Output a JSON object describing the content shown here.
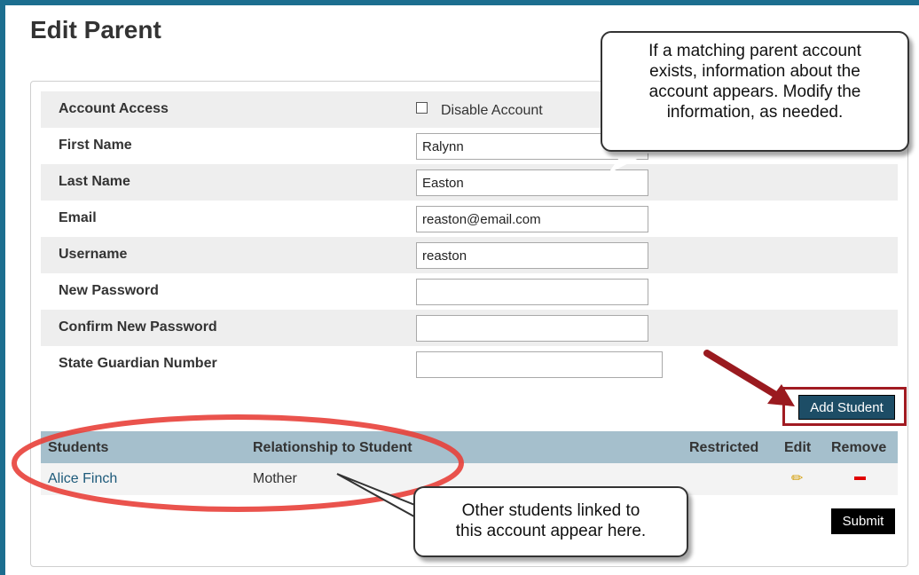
{
  "page": {
    "title": "Edit Parent"
  },
  "form": {
    "account_access": {
      "label": "Account Access",
      "checkbox_label": "Disable Account",
      "checked": false
    },
    "first_name": {
      "label": "First Name",
      "value": "Ralynn"
    },
    "last_name": {
      "label": "Last Name",
      "value": "Easton"
    },
    "email": {
      "label": "Email",
      "value": "reaston@email.com"
    },
    "username": {
      "label": "Username",
      "value": "reaston"
    },
    "new_password": {
      "label": "New Password",
      "value": ""
    },
    "confirm_password": {
      "label": "Confirm New Password",
      "value": ""
    },
    "state_guardian_number": {
      "label": "State Guardian Number",
      "value": ""
    }
  },
  "buttons": {
    "add_student": "Add Student",
    "submit": "Submit"
  },
  "students_table": {
    "headers": {
      "students": "Students",
      "relationship": "Relationship to Student",
      "restricted": "Restricted",
      "edit": "Edit",
      "remove": "Remove"
    },
    "rows": [
      {
        "student": "Alice Finch",
        "relationship": "Mother"
      }
    ]
  },
  "callouts": {
    "top": [
      "If a matching parent account",
      "exists, information about the",
      "account appears. Modify the",
      "information, as needed."
    ],
    "bottom": [
      "Other students linked to",
      "this account appear here."
    ]
  },
  "icons": {
    "edit": "pencil-icon",
    "remove": "minus-icon"
  },
  "colors": {
    "frame": "#1c6e8f",
    "table_header": "#a5bfcc",
    "add_button": "#1d4d66",
    "highlight": "#a11b22",
    "annotation_ellipse": "#e8403a"
  }
}
